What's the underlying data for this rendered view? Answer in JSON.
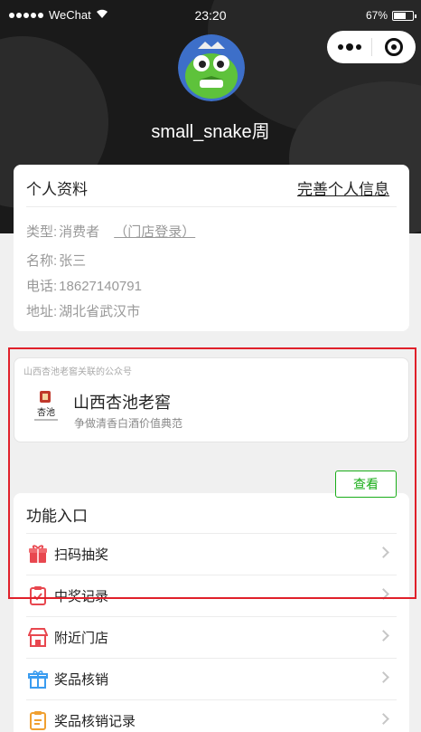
{
  "status_bar": {
    "carrier": "WeChat",
    "time": "23:20",
    "battery": "67%",
    "battery_level": 0.67
  },
  "header": {
    "username": "small_snake周"
  },
  "profile": {
    "title": "个人资料",
    "complete_link": "完善个人信息",
    "type_label": "类型:",
    "type_value": "消费者",
    "store_login": "（门店登录）",
    "name_label": "名称:",
    "name_value": "张三",
    "phone_label": "电话:",
    "phone_value": "18627140791",
    "address_label": "地址:",
    "address_value": "湖北省武汉市"
  },
  "official_account": {
    "caption": "山西杏池老窖关联的公众号",
    "name": "山西杏池老窖",
    "slogan": "争做清香白酒价值典范",
    "logo_text": "杏池"
  },
  "view_button": "查看",
  "functions": {
    "title": "功能入口",
    "items": [
      {
        "label": "扫码抽奖",
        "icon": "gift-box-icon",
        "color": "#e8474f"
      },
      {
        "label": "中奖记录",
        "icon": "clipboard-icon",
        "color": "#e8474f"
      },
      {
        "label": "附近门店",
        "icon": "store-icon",
        "color": "#e8474f"
      },
      {
        "label": "奖品核销",
        "icon": "gift-icon",
        "color": "#3a9cf0"
      },
      {
        "label": "奖品核销记录",
        "icon": "clipboard-icon",
        "color": "#f0a030"
      }
    ]
  },
  "colors": {
    "header_bg": "#1a1a1a",
    "accent_green": "#1aad19",
    "highlight_red": "#e0202a"
  }
}
